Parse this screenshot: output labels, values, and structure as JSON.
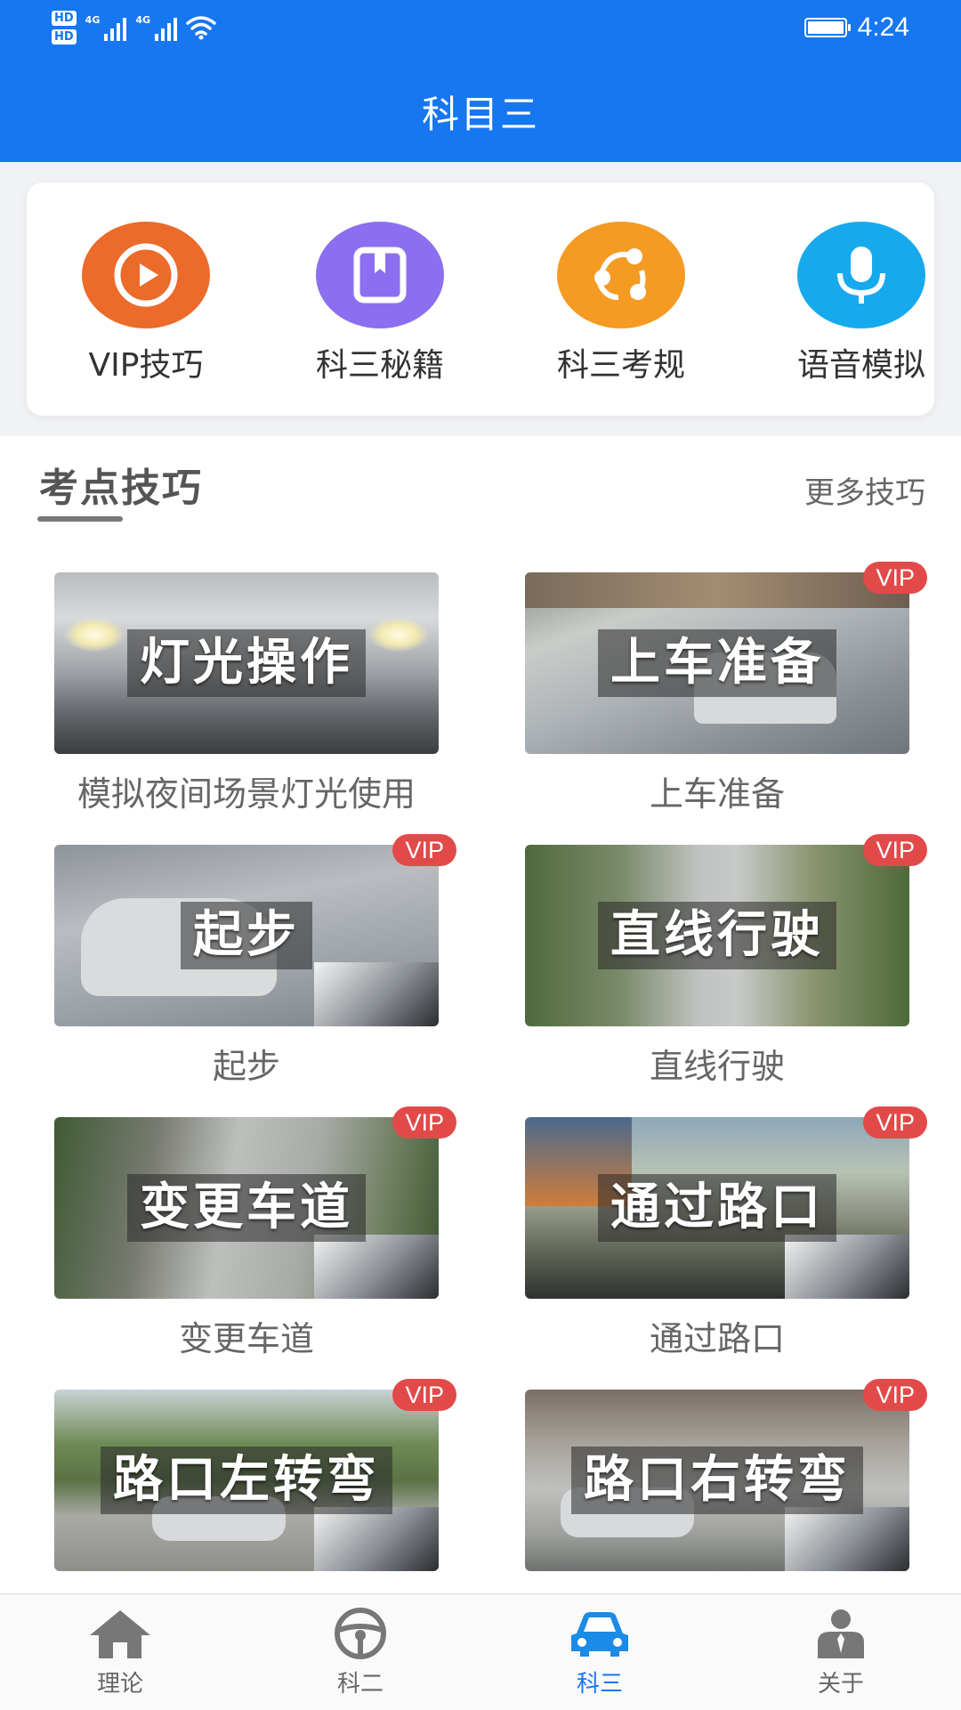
{
  "status_bar": {
    "hd1": "HD",
    "hd2": "HD",
    "sig1_label": "4G",
    "sig2_label": "4G",
    "time": "4:24"
  },
  "app_bar": {
    "title": "科目三"
  },
  "quick_menu": [
    {
      "label": "VIP技巧",
      "icon": "play-icon",
      "color": "#ec6a2a"
    },
    {
      "label": "科三秘籍",
      "icon": "book-icon",
      "color": "#8b6ff0"
    },
    {
      "label": "科三考规",
      "icon": "share-icon",
      "color": "#f59a23"
    },
    {
      "label": "语音模拟",
      "icon": "microphone-icon",
      "color": "#17a9ee"
    }
  ],
  "section": {
    "title": "考点技巧",
    "more": "更多技巧"
  },
  "lessons": [
    {
      "caption": "灯光操作",
      "desc": "模拟夜间场景灯光使用",
      "vip": false
    },
    {
      "caption": "上车准备",
      "desc": "上车准备",
      "vip": true
    },
    {
      "caption": "起步",
      "desc": "起步",
      "vip": true
    },
    {
      "caption": "直线行驶",
      "desc": "直线行驶",
      "vip": true
    },
    {
      "caption": "变更车道",
      "desc": "变更车道",
      "vip": true
    },
    {
      "caption": "通过路口",
      "desc": "通过路口",
      "vip": true
    },
    {
      "caption": "路口左转弯",
      "desc": "",
      "vip": true
    },
    {
      "caption": "路口右转弯",
      "desc": "",
      "vip": true
    }
  ],
  "vip_badge": "VIP",
  "tabs": [
    {
      "label": "理论",
      "icon": "house-icon",
      "active": false
    },
    {
      "label": "科二",
      "icon": "steering-wheel-icon",
      "active": false
    },
    {
      "label": "科三",
      "icon": "car-icon",
      "active": true
    },
    {
      "label": "关于",
      "icon": "person-icon",
      "active": false
    }
  ],
  "colors": {
    "primary": "#1677f0",
    "vip_badge": "#e24a4a"
  }
}
